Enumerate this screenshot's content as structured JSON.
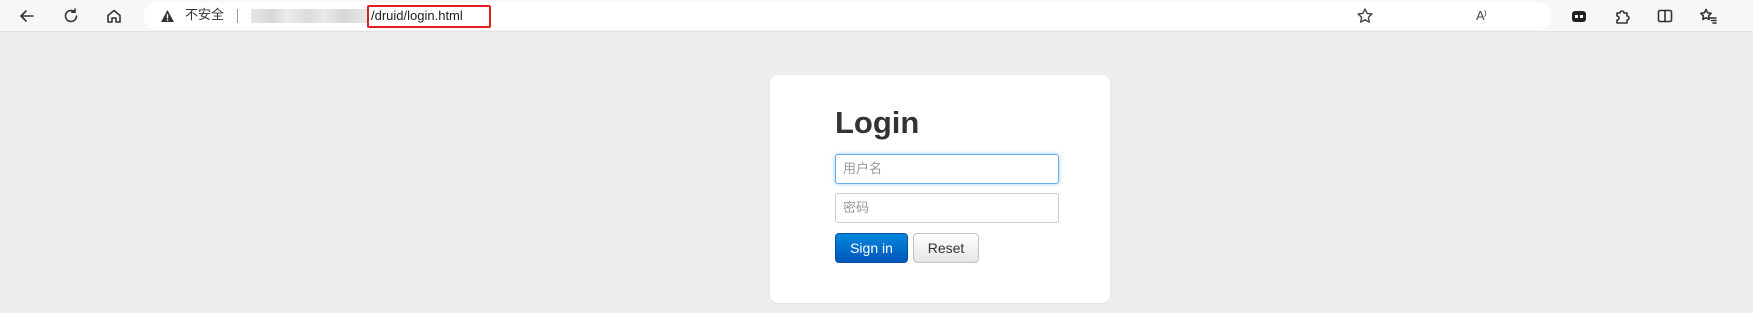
{
  "browser": {
    "security_label": "不安全",
    "url_path": "/druid/login.html",
    "read_aloud_label": "A⁾",
    "icons": [
      "back-icon",
      "refresh-icon",
      "home-icon",
      "warning-icon",
      "read-aloud-icon",
      "favorite-star-icon",
      "extension-badge-icon",
      "extensions-puzzle-icon",
      "split-screen-icon",
      "favorites-icon"
    ]
  },
  "login": {
    "title": "Login",
    "username_placeholder": "用户名",
    "password_placeholder": "密码",
    "signin_label": "Sign in",
    "reset_label": "Reset"
  },
  "colors": {
    "page_background": "#eeeeee",
    "url_highlight": "#e02020",
    "primary_button": "#0066cc"
  }
}
